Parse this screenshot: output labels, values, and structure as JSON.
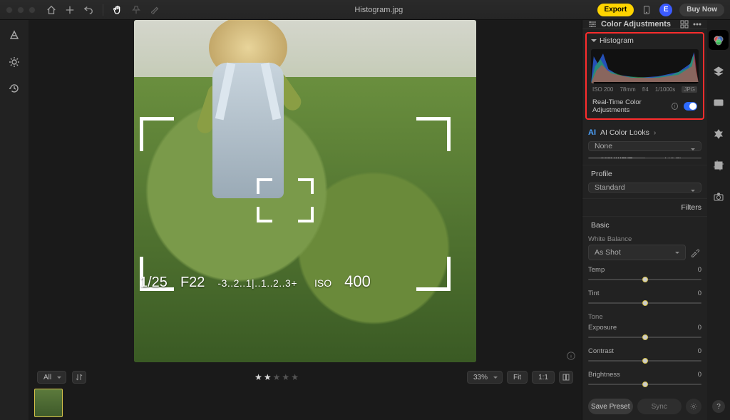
{
  "title": "Histogram.jpg",
  "topbar": {
    "export": "Export",
    "avatar": "E",
    "buy": "Buy Now"
  },
  "viewfinder": {
    "shutter": "1/25",
    "aperture": "F22",
    "ev_scale": "-3..2..1|..1..2..3+",
    "iso_label": "ISO",
    "iso_value": "400"
  },
  "bottom": {
    "filter_all": "All",
    "zoom_pct": "33%",
    "fit": "Fit",
    "one_to_one": "1:1",
    "rating": 2
  },
  "right": {
    "title": "Color Adjustments",
    "histogram": {
      "label": "Histogram",
      "meta_iso": "ISO 200",
      "meta_focal": "78mm",
      "meta_f": "f/4",
      "meta_shutter": "1/1000s",
      "meta_fmt": "JPG"
    },
    "realtime_label": "Real-Time Color Adjustments",
    "ai_looks": {
      "badge": "AI",
      "label": "AI Color Looks",
      "selected": "None"
    },
    "scope": {
      "full": "Full Image",
      "local": "Local"
    },
    "profile": {
      "label": "Profile",
      "selected": "Standard"
    },
    "filters_label": "Filters",
    "basic": {
      "label": "Basic",
      "white_balance_label": "White Balance",
      "white_balance_value": "As Shot",
      "temp_label": "Temp",
      "temp_value": "0",
      "tint_label": "Tint",
      "tint_value": "0",
      "tone_label": "Tone",
      "exposure_label": "Exposure",
      "exposure_value": "0",
      "contrast_label": "Contrast",
      "contrast_value": "0",
      "brightness_label": "Brightness",
      "brightness_value": "0"
    },
    "footer": {
      "save": "Save Preset",
      "sync": "Sync"
    }
  }
}
